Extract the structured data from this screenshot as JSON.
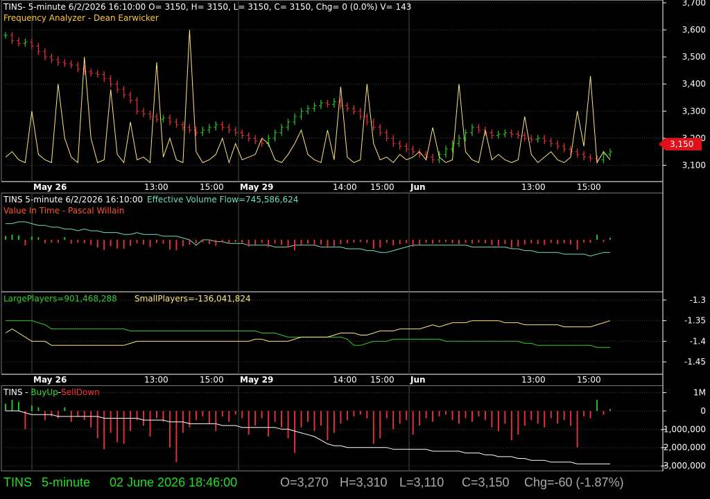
{
  "colors": {
    "background": "#000000",
    "grid": "#3a3a3a",
    "panel_border": "#7a7a7a",
    "axis_text": "#ffffff",
    "up_bar": "#22c322",
    "down_bar": "#e0303a",
    "yellow_line": "#ffe680",
    "cyan_line": "#6ee0c0",
    "green_line": "#33cc33",
    "white_line": "#ffffff",
    "footer_green": "#22dd22",
    "footer_gray": "#aaaaaa",
    "price_marker": "#e0101a"
  },
  "panels": {
    "price": {
      "header_line1": "TINS- 5-minute 6/2/2026 16:10:00 O= 3150, H= 3150, L= 3150, C= 3150, Chg= 0 (0.0%) V= 143",
      "header_line2": "Frequency Analyzer - Dean Earwicker",
      "last_price_label": "3,150"
    },
    "volume_flow": {
      "title": "TINS 5-minute  6/2/2026 16:10:00",
      "indicator": "Effective Volume Flow=745,586,624",
      "subtitle": "Value In Time - Pascal Willain"
    },
    "players": {
      "large_label": "LargePlayers=901,468,288",
      "small_label": "SmallPlayers=-136,041,824"
    },
    "buyup": {
      "prefix": "TINS - ",
      "buy_label": "BuyUp",
      "dash": "-",
      "sell_label": "SellDown"
    }
  },
  "time_axis_1": [
    "May 26",
    "13:00",
    "15:00",
    "May 29",
    "14:00",
    "15:00",
    "Jun",
    "13:00",
    "15:00"
  ],
  "time_axis_2": [
    "May 26",
    "13:00",
    "15:00",
    "May 29",
    "14:00",
    "15:00",
    "Jun",
    "13:00",
    "15:00"
  ],
  "footer": {
    "symbol": "TINS",
    "interval": "5-minute",
    "datetime": "02 June 2026 18:46:00",
    "open": "O=3,270",
    "high": "H=3,310",
    "low": "L=3,110",
    "close": "C=3,150",
    "change": "Chg=-60 (-1.87%)"
  },
  "chart_data": [
    {
      "type": "bar",
      "subtype": "ohlc_with_oscillator",
      "y_axis_ticks": [
        "3,700",
        "3,600",
        "3,500",
        "3,400",
        "3,300",
        "3,200",
        "3,100"
      ],
      "ylim": [
        3050,
        3700
      ],
      "close_series": [
        3580,
        3560,
        3550,
        3555,
        3540,
        3520,
        3500,
        3490,
        3480,
        3475,
        3470,
        3455,
        3445,
        3440,
        3435,
        3420,
        3400,
        3380,
        3360,
        3340,
        3300,
        3290,
        3280,
        3270,
        3275,
        3260,
        3250,
        3240,
        3230,
        3220,
        3230,
        3240,
        3250,
        3240,
        3230,
        3220,
        3210,
        3200,
        3190,
        3180,
        3200,
        3220,
        3240,
        3260,
        3280,
        3300,
        3310,
        3320,
        3330,
        3325,
        3335,
        3320,
        3310,
        3300,
        3280,
        3260,
        3240,
        3220,
        3200,
        3180,
        3170,
        3160,
        3150,
        3140,
        3130,
        3120,
        3140,
        3160,
        3180,
        3200,
        3220,
        3240,
        3230,
        3220,
        3210,
        3215,
        3220,
        3215,
        3210,
        3200,
        3195,
        3200,
        3190,
        3180,
        3170,
        3160,
        3150,
        3140,
        3130,
        3125,
        3120,
        3140,
        3150
      ],
      "oscillator_series": [
        3130,
        3150,
        3120,
        3110,
        3300,
        3140,
        3120,
        3110,
        3400,
        3200,
        3130,
        3110,
        3500,
        3200,
        3110,
        3120,
        3380,
        3140,
        3110,
        3260,
        3120,
        3130,
        3110,
        3480,
        3130,
        3200,
        3120,
        3110,
        3600,
        3150,
        3110,
        3120,
        3140,
        3200,
        3110,
        3180,
        3120,
        3130,
        3140,
        3200,
        3180,
        3120,
        3110,
        3140,
        3180,
        3230,
        3140,
        3120,
        3110,
        3230,
        3120,
        3390,
        3130,
        3110,
        3120,
        3400,
        3180,
        3120,
        3130,
        3110,
        3140,
        3120,
        3130,
        3150,
        3120,
        3240,
        3130,
        3110,
        3120,
        3400,
        3150,
        3120,
        3110,
        3230,
        3120,
        3140,
        3120,
        3110,
        3120,
        3280,
        3140,
        3110,
        3130,
        3150,
        3120,
        3110,
        3130,
        3300,
        3170,
        3430,
        3110,
        3150,
        3120
      ]
    },
    {
      "type": "bar",
      "subtype": "volume_histogram_with_line",
      "series": [
        {
          "name": "Effective Volume Flow",
          "values": [
            0.9,
            0.9,
            1.0,
            1.0,
            0.9,
            0.8,
            0.8,
            0.7,
            0.7,
            0.6,
            0.6,
            0.5,
            0.6,
            0.5,
            0.5,
            0.4,
            0.4,
            0.4,
            0.3,
            0.3,
            0.4,
            0.3,
            0.3,
            0.3,
            0.2,
            0.2,
            0.2,
            0.1,
            0.0,
            -0.3,
            0.0,
            0.0,
            -0.1,
            -0.1,
            -0.2,
            -0.2,
            -0.2,
            -0.3,
            -0.3,
            -0.3,
            -0.3,
            -0.4,
            -0.4,
            -0.4,
            -0.3,
            -0.3,
            -0.3,
            -0.3,
            -0.4,
            -0.4,
            -0.4,
            -0.4,
            -0.5,
            -0.5,
            -0.5,
            -0.6,
            -0.6,
            -0.7,
            -0.7,
            -0.6,
            -0.5,
            -0.4,
            -0.3,
            -0.3,
            -0.3,
            -0.3,
            -0.3,
            -0.3,
            -0.3,
            -0.3,
            -0.3,
            -0.4,
            -0.4,
            -0.4,
            -0.4,
            -0.4,
            -0.4,
            -0.5,
            -0.5,
            -0.6,
            -0.6,
            -0.7,
            -0.7,
            -0.7,
            -0.7,
            -0.8,
            -0.8,
            -0.8,
            -0.8,
            -0.9,
            -0.8,
            -0.7,
            -0.7
          ]
        }
      ]
    },
    {
      "type": "line",
      "y_axis_ticks": [
        "-1.3",
        "-1.35",
        "-1.4",
        "-1.45"
      ],
      "ylim": [
        -1.48,
        -1.28
      ],
      "series": [
        {
          "name": "LargePlayers",
          "values": [
            -1.35,
            -1.35,
            -1.35,
            -1.35,
            -1.35,
            -1.355,
            -1.36,
            -1.37,
            -1.37,
            -1.37,
            -1.37,
            -1.37,
            -1.37,
            -1.37,
            -1.37,
            -1.37,
            -1.37,
            -1.37,
            -1.37,
            -1.375,
            -1.375,
            -1.375,
            -1.375,
            -1.375,
            -1.375,
            -1.375,
            -1.375,
            -1.375,
            -1.375,
            -1.375,
            -1.375,
            -1.375,
            -1.375,
            -1.375,
            -1.375,
            -1.375,
            -1.375,
            -1.375,
            -1.375,
            -1.38,
            -1.38,
            -1.38,
            -1.385,
            -1.39,
            -1.39,
            -1.39,
            -1.39,
            -1.39,
            -1.39,
            -1.39,
            -1.39,
            -1.39,
            -1.395,
            -1.41,
            -1.41,
            -1.405,
            -1.4,
            -1.4,
            -1.4,
            -1.395,
            -1.395,
            -1.395,
            -1.395,
            -1.395,
            -1.395,
            -1.395,
            -1.395,
            -1.4,
            -1.4,
            -1.4,
            -1.4,
            -1.4,
            -1.4,
            -1.4,
            -1.4,
            -1.4,
            -1.4,
            -1.4,
            -1.4,
            -1.405,
            -1.405,
            -1.41,
            -1.41,
            -1.41,
            -1.41,
            -1.41,
            -1.41,
            -1.41,
            -1.41,
            -1.41,
            -1.415,
            -1.415,
            -1.415
          ]
        },
        {
          "name": "SmallPlayers",
          "values": [
            -1.38,
            -1.37,
            -1.38,
            -1.39,
            -1.4,
            -1.4,
            -1.4,
            -1.41,
            -1.41,
            -1.41,
            -1.41,
            -1.41,
            -1.41,
            -1.41,
            -1.41,
            -1.41,
            -1.41,
            -1.41,
            -1.41,
            -1.405,
            -1.4,
            -1.4,
            -1.4,
            -1.4,
            -1.4,
            -1.4,
            -1.4,
            -1.4,
            -1.4,
            -1.4,
            -1.4,
            -1.4,
            -1.4,
            -1.4,
            -1.4,
            -1.4,
            -1.4,
            -1.4,
            -1.395,
            -1.395,
            -1.4,
            -1.4,
            -1.4,
            -1.4,
            -1.395,
            -1.39,
            -1.39,
            -1.39,
            -1.39,
            -1.39,
            -1.385,
            -1.38,
            -1.38,
            -1.38,
            -1.385,
            -1.385,
            -1.38,
            -1.375,
            -1.375,
            -1.375,
            -1.37,
            -1.37,
            -1.37,
            -1.37,
            -1.365,
            -1.36,
            -1.365,
            -1.36,
            -1.355,
            -1.355,
            -1.355,
            -1.35,
            -1.35,
            -1.35,
            -1.35,
            -1.35,
            -1.355,
            -1.355,
            -1.355,
            -1.36,
            -1.36,
            -1.36,
            -1.36,
            -1.36,
            -1.36,
            -1.365,
            -1.365,
            -1.365,
            -1.365,
            -1.365,
            -1.36,
            -1.355,
            -1.35
          ]
        }
      ]
    },
    {
      "type": "bar",
      "subtype": "histogram_with_cumulative_line",
      "y_axis_ticks": [
        "1M",
        "0",
        "-1,000,000",
        "-2,000,000",
        "-3,000,000"
      ],
      "ylim": [
        -3300000,
        1400000
      ],
      "series": [
        {
          "name": "BuyUp-SellDown",
          "values": [
            400000,
            600000,
            500000,
            -1000000,
            300000,
            200000,
            -500000,
            -300000,
            -400000,
            200000,
            -600000,
            -300000,
            -500000,
            -900000,
            -1500000,
            -2100000,
            -1200000,
            -1700000,
            -1800000,
            -1100000,
            -500000,
            -800000,
            -1400000,
            -400000,
            -600000,
            -2000000,
            -2800000,
            -1200000,
            -900000,
            -500000,
            -300000,
            -700000,
            -1100000,
            -300000,
            -600000,
            -200000,
            -400000,
            -1300000,
            -800000,
            -400000,
            -1400000,
            -600000,
            -900000,
            -1500000,
            -2300000,
            -900000,
            -600000,
            -1100000,
            -800000,
            -1600000,
            -1200000,
            -700000,
            -500000,
            -300000,
            -200000,
            -400000,
            -1800000,
            -1500000,
            -400000,
            -1000000,
            -700000,
            -500000,
            -1300000,
            -800000,
            -400000,
            -600000,
            -300000,
            -200000,
            -500000,
            -700000,
            -400000,
            -600000,
            -300000,
            -500000,
            -900000,
            -1100000,
            -700000,
            -1600000,
            -1300000,
            -800000,
            -500000,
            -700000,
            -900000,
            -400000,
            -700000,
            -500000,
            -800000,
            -2000000,
            -300000,
            -400000,
            600000,
            -200000,
            100000
          ]
        },
        {
          "name": "cumulative",
          "values": [
            0,
            0,
            0,
            -100000,
            -200000,
            -200000,
            -200000,
            -200000,
            -300000,
            -300000,
            -300000,
            -300000,
            -300000,
            -300000,
            -300000,
            -400000,
            -400000,
            -400000,
            -400000,
            -400000,
            -400000,
            -500000,
            -500000,
            -500000,
            -500000,
            -600000,
            -600000,
            -600000,
            -700000,
            -700000,
            -700000,
            -700000,
            -700000,
            -800000,
            -800000,
            -800000,
            -900000,
            -900000,
            -900000,
            -900000,
            -900000,
            -900000,
            -1000000,
            -1000000,
            -1100000,
            -1200000,
            -1300000,
            -1400000,
            -1600000,
            -1800000,
            -1900000,
            -1900000,
            -2000000,
            -2000000,
            -2000000,
            -2000000,
            -2000000,
            -2000000,
            -2000000,
            -2100000,
            -2100000,
            -2100000,
            -2100000,
            -2100000,
            -2100000,
            -2200000,
            -2200000,
            -2200000,
            -2200000,
            -2200000,
            -2300000,
            -2300000,
            -2300000,
            -2400000,
            -2400000,
            -2500000,
            -2500000,
            -2500000,
            -2600000,
            -2600000,
            -2700000,
            -2700000,
            -2700000,
            -2800000,
            -2800000,
            -2800000,
            -2800000,
            -2900000,
            -2900000,
            -2900000,
            -2900000,
            -2900000,
            -2900000
          ]
        }
      ]
    }
  ]
}
